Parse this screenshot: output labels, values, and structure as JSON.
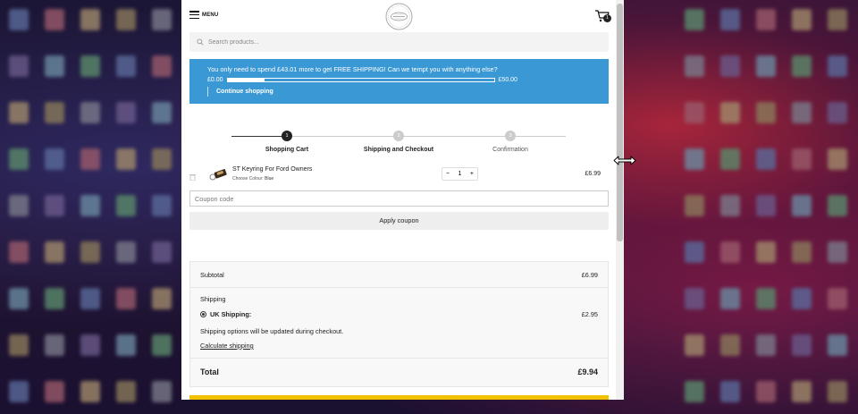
{
  "header": {
    "menu_label": "MENU",
    "cart_count": "1"
  },
  "search": {
    "placeholder": "Search products..."
  },
  "shipping_banner": {
    "message": "You only need to spend £43.01 more to get FREE SHIPPING! Can we tempt you with anything else?",
    "min_label": "£0.00",
    "max_label": "£50.00",
    "progress_fraction": 0.14,
    "continue_label": "Continue shopping",
    "color": "#3a98d4"
  },
  "steps": [
    {
      "number": "1",
      "label": "Shopping Cart",
      "active": true
    },
    {
      "number": "2",
      "label": "Shipping and Checkout",
      "active": false
    },
    {
      "number": "3",
      "label": "Confirmation",
      "active": false
    }
  ],
  "cart_item": {
    "name": "ST Keyring For Ford Owners",
    "option_label": "Choose Colour:",
    "option_value": "Blue",
    "quantity": "1",
    "minus": "−",
    "plus": "+",
    "price": "£6.99"
  },
  "coupon": {
    "placeholder": "Coupon code",
    "apply_label": "Apply coupon"
  },
  "totals": {
    "subtotal_label": "Subtotal",
    "subtotal_value": "£6.99",
    "shipping_heading": "Shipping",
    "shipping_method": "UK Shipping:",
    "shipping_value": "£2.95",
    "shipping_note": "Shipping options will be updated during checkout.",
    "calculate_label": "Calculate shipping",
    "total_label": "Total",
    "total_value": "£9.94"
  },
  "colors": {
    "accent": "#3a98d4",
    "checkout": "#f2c200",
    "step_active": "#222222",
    "step_inactive": "#cccccc"
  }
}
